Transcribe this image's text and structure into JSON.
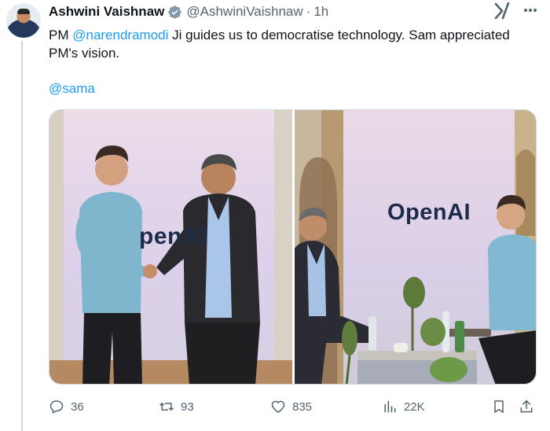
{
  "tweet": {
    "author_name": "Ashwini Vaishnaw",
    "handle": "@AshwiniVaishnaw",
    "separator": "·",
    "time": "1h",
    "text_prefix": "PM ",
    "mention_1": "@narendramodi",
    "text_suffix": " Ji guides us to democratise technology. Sam appreciated PM's vision.",
    "tag": "@sama",
    "verified_icon": "verified-badge-icon",
    "verified_color": "#829aab",
    "link_color": "#1d9bf0"
  },
  "media": {
    "left_photo_sign": "penAI",
    "right_photo_sign": "OpenAI"
  },
  "actions": {
    "replies": "36",
    "reposts": "93",
    "likes": "835",
    "views": "22K"
  }
}
